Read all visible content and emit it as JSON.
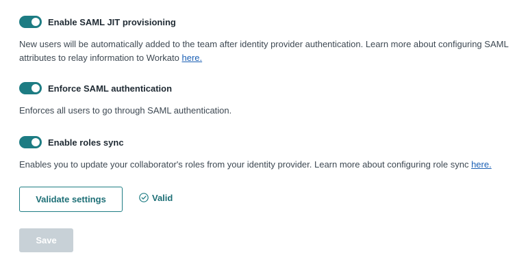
{
  "settings": [
    {
      "title": "Enable SAML JIT provisioning",
      "enabled": true,
      "desc_text": "New users will be automatically added to the team after identity provider authentication. Learn more about configuring SAML attributes to relay information to Workato ",
      "link_text": "here."
    },
    {
      "title": "Enforce SAML authentication",
      "enabled": true,
      "desc_text": "Enforces all users to go through SAML authentication."
    },
    {
      "title": "Enable roles sync",
      "enabled": true,
      "desc_text": "Enables you to update your collaborator's roles from your identity provider. Learn more about configuring role sync ",
      "link_text": "here."
    }
  ],
  "validate": {
    "button_label": "Validate settings",
    "status_text": "Valid",
    "status_icon": "check-circle-icon"
  },
  "save": {
    "label": "Save",
    "disabled": true
  },
  "colors": {
    "toggle_on": "#1d7c83",
    "link": "#1a5fb4",
    "save_disabled": "#c8d1d7",
    "accent_text": "#1d6f76"
  }
}
